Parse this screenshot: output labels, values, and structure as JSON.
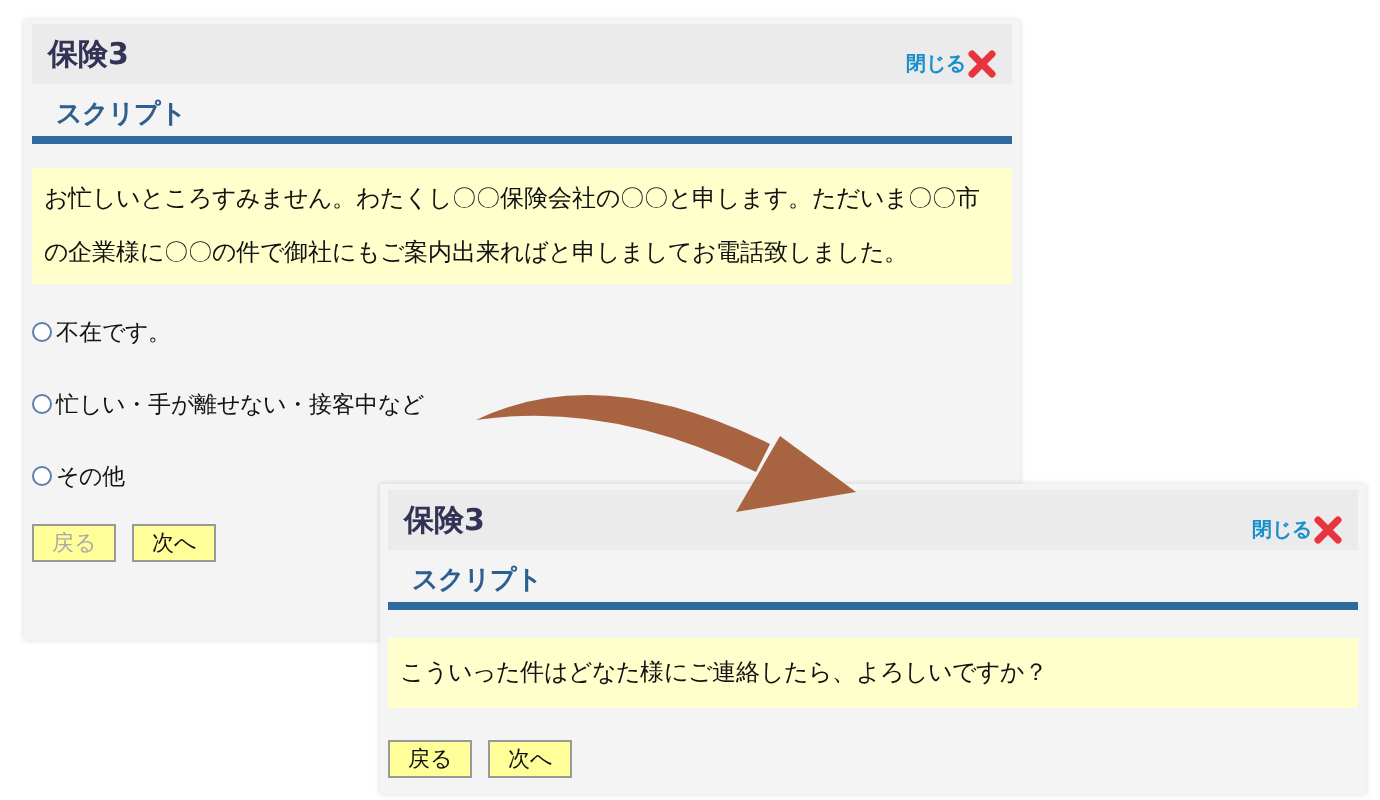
{
  "panels": [
    {
      "title": "保険3",
      "close_label": "閉じる",
      "section_heading": "スクリプト",
      "script_text": "お忙しいところすみません。わたくし〇〇保険会社の〇〇と申します。ただいま〇〇市の企業様に〇〇の件で御社にもご案内出来ればと申しましてお電話致しました。",
      "options": [
        {
          "label": "不在です。",
          "selected": false
        },
        {
          "label": "忙しい・手が離せない・接客中など",
          "selected": false
        },
        {
          "label": "その他",
          "selected": false
        }
      ],
      "buttons": [
        {
          "label": "戻る",
          "disabled": true
        },
        {
          "label": "次へ",
          "disabled": false
        }
      ]
    },
    {
      "title": "保険3",
      "close_label": "閉じる",
      "section_heading": "スクリプト",
      "script_text": "こういった件はどなた様にご連絡したら、よろしいですか？",
      "buttons": [
        {
          "label": "戻る",
          "disabled": false
        },
        {
          "label": "次へ",
          "disabled": false
        }
      ]
    }
  ]
}
